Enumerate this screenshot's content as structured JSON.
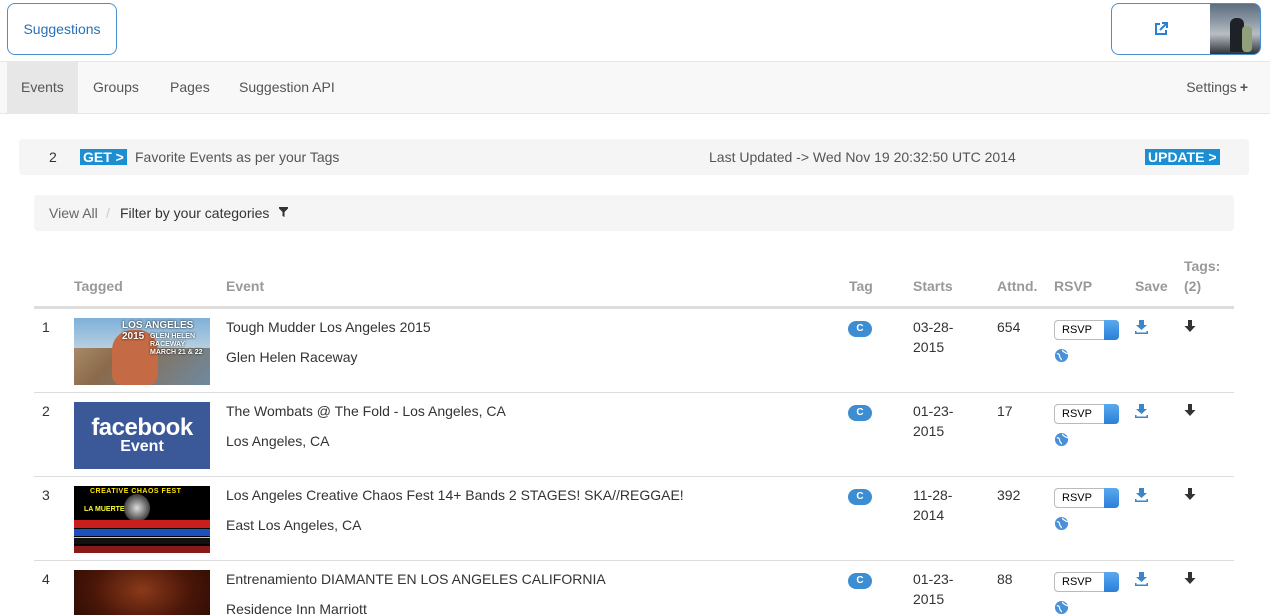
{
  "header": {
    "brand_label": "Suggestions",
    "external_icon": "external-link-icon"
  },
  "nav": {
    "tabs": [
      {
        "label": "Events",
        "active": true
      },
      {
        "label": "Groups",
        "active": false
      },
      {
        "label": "Pages",
        "active": false
      },
      {
        "label": "Suggestion API",
        "active": false
      }
    ],
    "settings_label": "Settings",
    "settings_icon": "plus-icon"
  },
  "infobar": {
    "count": "2",
    "get_label": "GET >",
    "description": "Favorite Events as per your Tags",
    "last_updated": "Last Updated -> Wed Nov 19 20:32:50 UTC 2014",
    "update_label": "UPDATE >"
  },
  "filters": {
    "view_all": "View All",
    "separator": "/",
    "filter_label": "Filter by your categories"
  },
  "table": {
    "headers": {
      "tagged": "Tagged",
      "event": "Event",
      "tag": "Tag",
      "starts": "Starts",
      "attendees": "Attnd.",
      "rsvp": "RSVP",
      "save": "Save",
      "tags_line1": "Tags:",
      "tags_line2": "(2)"
    },
    "rows": [
      {
        "index": "1",
        "title": "Tough Mudder Los Angeles 2015",
        "location": "Glen Helen Raceway",
        "tag": "C",
        "start_line1": "03-28-",
        "start_line2": "2015",
        "attendees": "654",
        "rsvp": "RSVP",
        "thumb_title": "LOS ANGELES 2015",
        "thumb_sub": "GLEN HELEN RACEWAY MARCH 21 & 22"
      },
      {
        "index": "2",
        "title": "The Wombats @ The Fold - Los Angeles, CA",
        "location": "Los Angeles, CA",
        "tag": "C",
        "start_line1": "01-23-",
        "start_line2": "2015",
        "attendees": "17",
        "rsvp": "RSVP",
        "thumb_title": "facebook",
        "thumb_sub": "Event"
      },
      {
        "index": "3",
        "title": "Los Angeles Creative Chaos Fest 14+ Bands 2 STAGES! SKA//REGGAE!",
        "location": "East Los Angeles, CA",
        "tag": "C",
        "start_line1": "11-28-",
        "start_line2": "2014",
        "attendees": "392",
        "rsvp": "RSVP",
        "thumb_title": "CREATIVE CHAOS FEST",
        "thumb_sub": "LA MUERTE"
      },
      {
        "index": "4",
        "title": "Entrenamiento DIAMANTE EN LOS ANGELES CALIFORNIA",
        "location": "Residence Inn Marriott",
        "tag": "C",
        "start_line1": "01-23-",
        "start_line2": "2015",
        "attendees": "88",
        "rsvp": "RSVP"
      }
    ]
  },
  "colors": {
    "accent": "#1b8fd2",
    "tag_pill": "#3c8dd2",
    "facebook": "#3b5998"
  }
}
